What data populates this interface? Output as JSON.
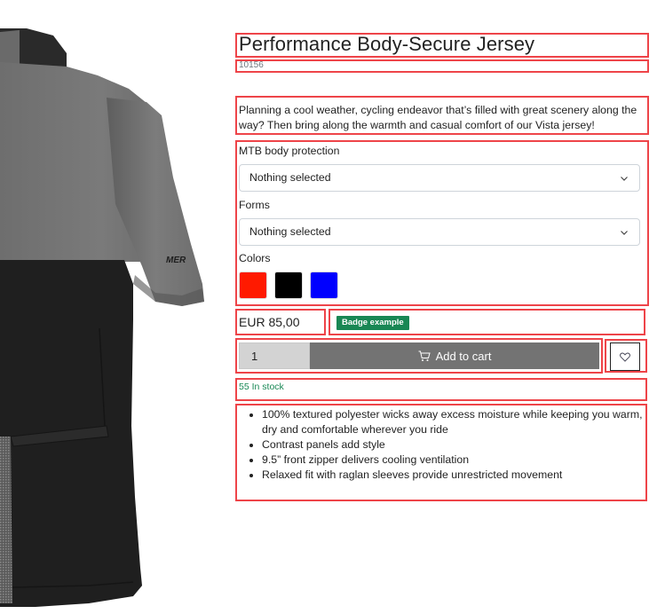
{
  "product": {
    "title": "Performance Body-Secure Jersey",
    "sku": "10156",
    "description": "Planning a cool weather, cycling endeavor that’s filled with great scenery along the way? Then bring along the warmth and casual comfort of our Vista jersey!",
    "image_alt": "Grey and black cycling jersey, rear view with sleeve logo",
    "image_logo_text": "MER"
  },
  "options": {
    "body_protection": {
      "label": "MTB body protection",
      "selected": "Nothing selected"
    },
    "forms": {
      "label": "Forms",
      "selected": "Nothing selected"
    },
    "colors": {
      "label": "Colors",
      "swatches": [
        {
          "name": "red",
          "hex": "#ff1a00"
        },
        {
          "name": "black",
          "hex": "#000000"
        },
        {
          "name": "blue",
          "hex": "#0000ff"
        }
      ]
    }
  },
  "pricing": {
    "price": "EUR 85,00",
    "badge": "Badge example"
  },
  "cart": {
    "quantity": "1",
    "add_label": "Add to cart"
  },
  "stock": {
    "text": "55 In stock"
  },
  "features": [
    "100% textured polyester wicks away excess moisture while keeping you warm, dry and comfortable wherever you ride",
    "Contrast panels add style",
    "9.5” front zipper delivers cooling ventilation",
    "Relaxed fit with raglan sleeves provide unrestricted movement"
  ],
  "colors": {
    "outline": "#ee4449",
    "badge_bg": "#198754",
    "stock_text": "#198754",
    "add_button_bg": "#737373",
    "qty_bg": "#d3d3d3"
  }
}
